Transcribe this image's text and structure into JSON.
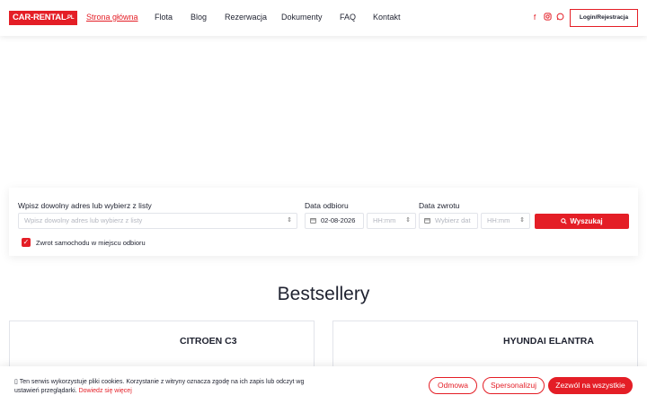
{
  "header": {
    "logo": "CAR-RENTAL",
    "logo_suffix": ".PL",
    "nav": [
      {
        "label": "Strona główna",
        "active": true
      },
      {
        "label": "Flota"
      },
      {
        "label": "Blog"
      },
      {
        "label": "Rezerwacja"
      },
      {
        "label": "Dokumenty"
      },
      {
        "label": "FAQ"
      },
      {
        "label": "Kontakt"
      }
    ],
    "social_icons": [
      "facebook-icon",
      "instagram-icon",
      "whatsapp-icon"
    ],
    "login_label": "Login/Rejestracja"
  },
  "search": {
    "address_label": "Wpisz dowolny adres lub wybierz z listy",
    "address_placeholder": "Wpisz dowolny adres lub wybierz z listy",
    "pickup_label": "Data odbioru",
    "pickup_date": "02-08-2026",
    "pickup_time_placeholder": "HH:mm",
    "return_label": "Data zwrotu",
    "return_date_placeholder": "Wybierz dat",
    "return_time_placeholder": "HH:mm",
    "search_button": "Wyszukaj",
    "return_same_place_label": "Zwrot samochodu w miejscu odbioru",
    "return_same_place_checked": true
  },
  "bestsellers": {
    "title": "Bestsellery",
    "cars": [
      "CITROEN C3",
      "HYUNDAI ELANTRA"
    ]
  },
  "cookie": {
    "text": "Ten serwis wykorzystuje pliki cookies. Korzystanie z witryny oznacza zgodę na ich zapis lub odczyt wg ustawień przeglądarki.",
    "link": "Dowiedz się więcej",
    "reject": "Odmowa",
    "customize": "Spersonalizuj",
    "accept_all": "Zezwól na wszystkie"
  },
  "colors": {
    "accent": "#e41e26",
    "text": "#1f2230",
    "border": "#e2e4ea"
  }
}
